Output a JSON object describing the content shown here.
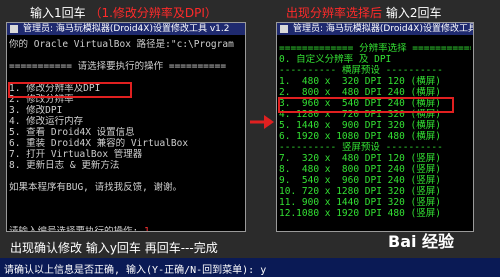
{
  "captions": {
    "left_white": "输入1回车",
    "left_red": "（1.修改分辨率及DPI）",
    "right_red": "出现分辨率选择后",
    "right_white": "输入2回车",
    "bottom_left": "出现确认修改 输入y回车 再回车---完成"
  },
  "left_window": {
    "title": "管理员: 海马玩模拟器(Droid4X)设置修改工具 v1.2",
    "lines": [
      "你的 Oracle VirtualBox 路径是:\"c:\\Program",
      "",
      "=========== 请选择要执行的操作 ==========",
      "",
      "1. 修改分辨率及DPI",
      "2. 修改分辨率",
      "3. 修改DPI",
      "4. 修改运行内存",
      "5. 查看 Droid4X 设置信息",
      "6. 重装 Droid4X 兼容的 VirtualBox",
      "7. 打开 VirtualBox 管理器",
      "8. 更新日志 & 更新方法",
      "",
      "如果本程序有BUG, 请找我反馈, 谢谢。",
      "",
      "",
      "",
      "请输入编号选择要执行的操作: "
    ],
    "input_value": "1"
  },
  "right_window": {
    "title": "管理员: 海马玩模拟器(Droid4X)设置修改工具",
    "lines": [
      "============= 分辨率选择 =============",
      "0. 自定义分辨率 及 DPI",
      "---------- 横屏预设 ----------",
      "1.  480 x  320 DPI 120 (横屏)",
      "2.  800 x  480 DPI 240 (横屏)",
      "3.  960 x  540 DPI 240 (横屏)",
      "4. 1280 x  720 DPI 320 (横屏)",
      "5. 1440 x  900 DPI 320 (横屏)",
      "6. 1920 x 1080 DPI 480 (横屏)",
      "---------- 竖屏预设 ----------",
      "7.  320 x  480 DPI 120 (竖屏)",
      "8.  480 x  800 DPI 240 (竖屏)",
      "9.  540 x  960 DPI 240 (竖屏)",
      "10. 720 x 1280 DPI 320 (竖屏)",
      "11. 900 x 1440 DPI 320 (竖屏)",
      "12.1080 x 1920 DPI 480 (竖屏)"
    ]
  },
  "bottom_bar": {
    "text": "请确认以上信息是否正确, 输入(Y-正确/N-回到菜单): y"
  },
  "watermark": "Bai 经验",
  "colors": {
    "accent_red": "#e02020",
    "terminal_green": "#33e033",
    "title_blue": "#1f2a6f"
  }
}
